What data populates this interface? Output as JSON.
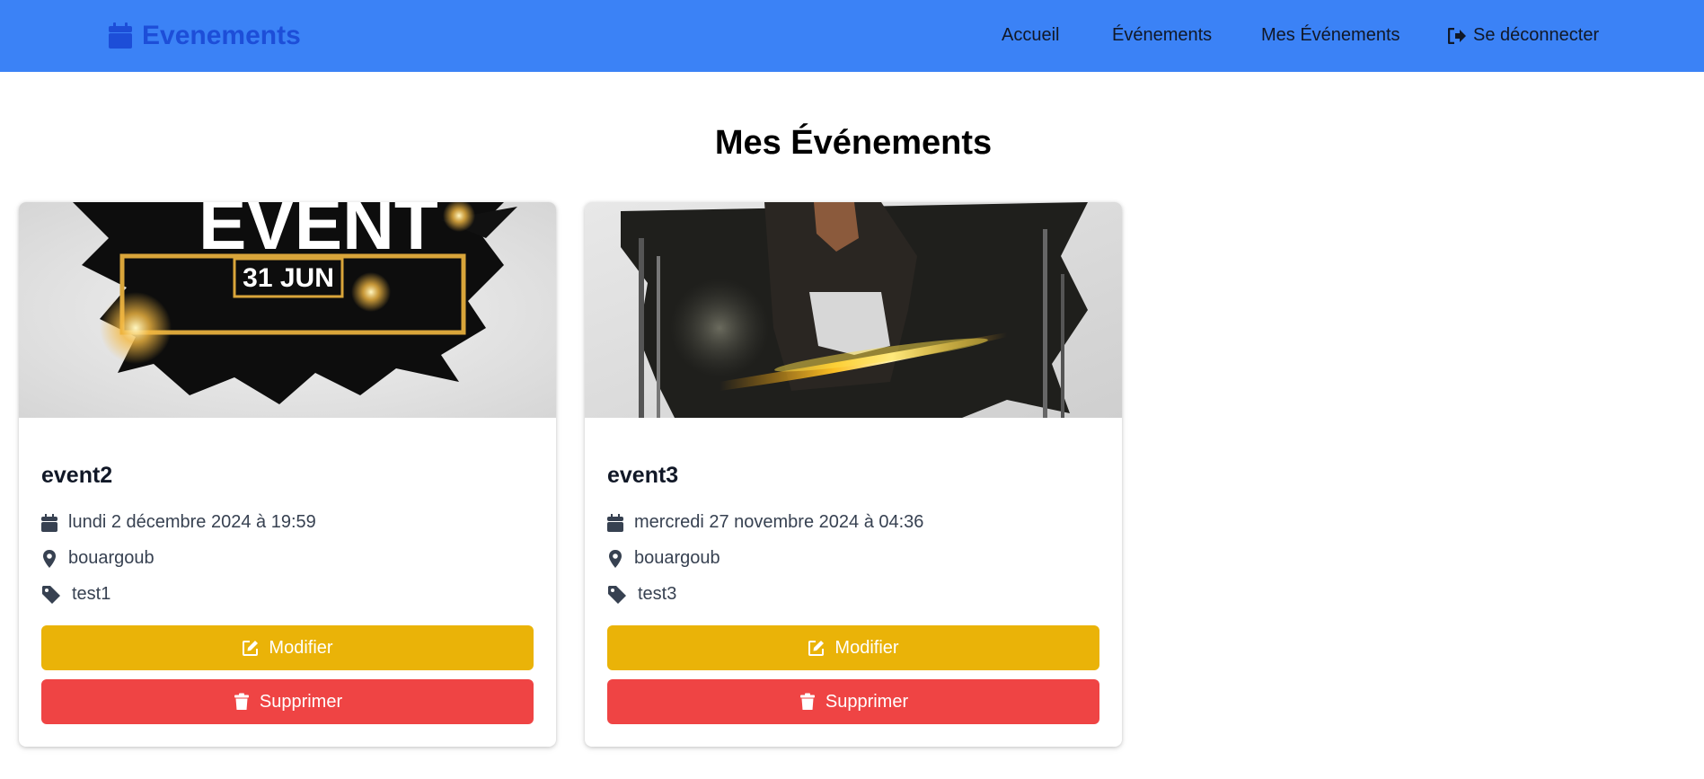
{
  "navbar": {
    "brand": "Evenements",
    "brand_icon": "calendar-icon",
    "links": [
      "Accueil",
      "Événements",
      "Mes Événements"
    ],
    "logout_label": "Se déconnecter",
    "logout_icon": "sign-out-icon",
    "background": "#3b82f6",
    "brand_color": "#1d4ed8"
  },
  "page": {
    "title": "Mes Événements"
  },
  "events": [
    {
      "name": "event2",
      "date": "lundi 2 décembre 2024 à 19:59",
      "location": "bouargoub",
      "category": "test1",
      "image_text": "EVENT",
      "image_date": "31 JUN",
      "edit_label": "Modifier",
      "delete_label": "Supprimer"
    },
    {
      "name": "event3",
      "date": "mercredi 27 novembre 2024 à 04:36",
      "location": "bouargoub",
      "category": "test3",
      "edit_label": "Modifier",
      "delete_label": "Supprimer"
    }
  ],
  "colors": {
    "edit_button": "#eab308",
    "delete_button": "#ef4444"
  }
}
